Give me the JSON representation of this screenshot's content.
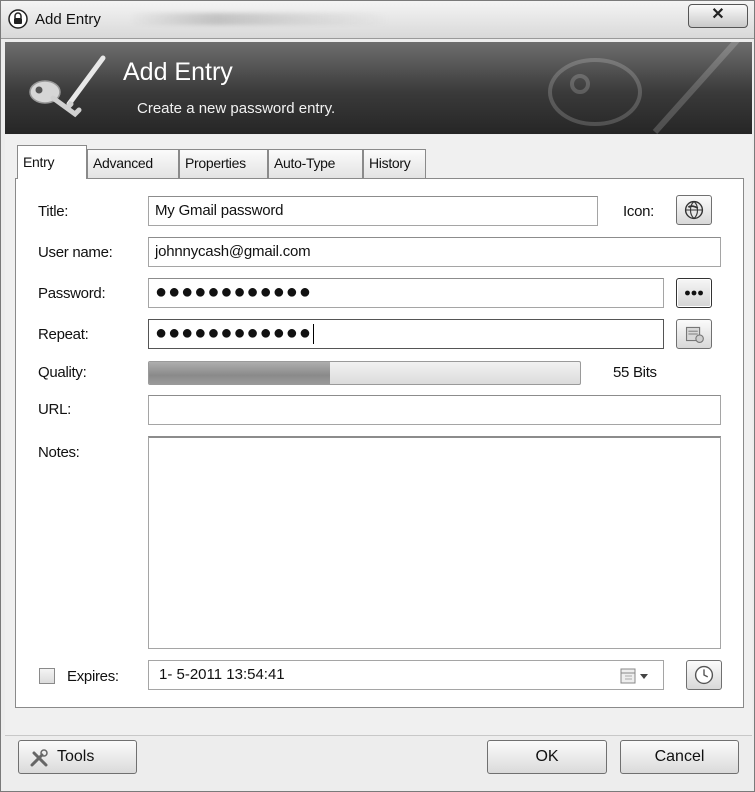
{
  "window": {
    "title": "Add Entry"
  },
  "banner": {
    "title": "Add Entry",
    "subtitle": "Create a new password entry."
  },
  "tabs": [
    {
      "label": "Entry",
      "active": true
    },
    {
      "label": "Advanced",
      "active": false
    },
    {
      "label": "Properties",
      "active": false
    },
    {
      "label": "Auto-Type",
      "active": false
    },
    {
      "label": "History",
      "active": false
    }
  ],
  "form": {
    "title_label": "Title:",
    "title_value": "My Gmail password",
    "icon_label": "Icon:",
    "username_label": "User name:",
    "username_value": "johnnycash@gmail.com",
    "password_label": "Password:",
    "password_value": "●●●●●●●●●●●●",
    "repeat_label": "Repeat:",
    "repeat_value": "●●●●●●●●●●●●",
    "quality_label": "Quality:",
    "quality_fraction": 0.42,
    "quality_text": "55 Bits",
    "url_label": "URL:",
    "url_value": "",
    "notes_label": "Notes:",
    "notes_value": "",
    "expires_label": "Expires:",
    "expires_checked": false,
    "expires_value": "1- 5-2011 13:54:41"
  },
  "buttons": {
    "tools": "Tools",
    "ok": "OK",
    "cancel": "Cancel"
  },
  "icons": {
    "app": "padlock-icon",
    "banner": "keys-pen-icon",
    "entry_icon": "globe-icon",
    "show_password": "dots-icon",
    "generator": "password-generator-icon",
    "calendar": "calendar-icon",
    "clock": "clock-icon",
    "tools": "tools-icon"
  }
}
